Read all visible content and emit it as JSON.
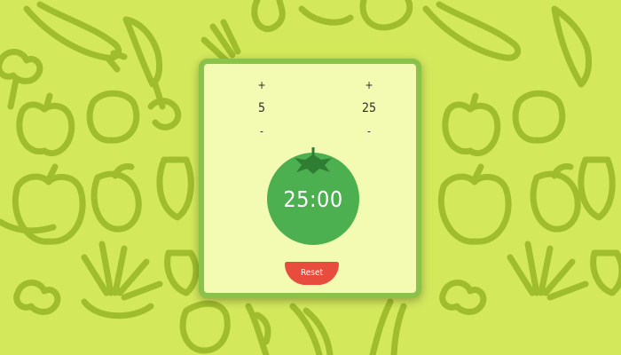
{
  "colors": {
    "background": "#d4e85c",
    "pattern": "#9fbd2c",
    "card": "#f3fbb2",
    "card_border": "#8bc34a",
    "tomato": "#4caf50",
    "leaf": "#2f7d32",
    "reset_button": "#e74c3c"
  },
  "background": {
    "pattern_icons": [
      "eggplant-icon",
      "carrot-icon",
      "apple-icon",
      "pepper-icon",
      "pear-icon",
      "pineapple-icon",
      "strawberry-icon",
      "broccoli-icon",
      "leek-icon"
    ]
  },
  "break_control": {
    "increment_label": "+",
    "value": "5",
    "decrement_label": "-"
  },
  "session_control": {
    "increment_label": "+",
    "value": "25",
    "decrement_label": "-"
  },
  "timer": {
    "display": "25:00",
    "icon": "tomato-icon"
  },
  "reset_button": {
    "label": "Reset"
  }
}
